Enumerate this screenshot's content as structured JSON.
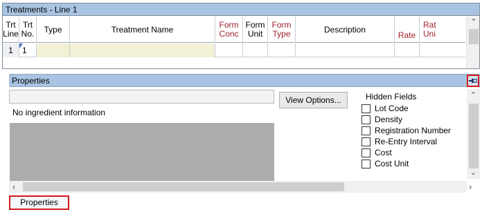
{
  "treatments_panel": {
    "title": "Treatments - Line 1",
    "columns": [
      {
        "label": "Trt\nLine",
        "required": false
      },
      {
        "label": "Trt\nNo.",
        "required": false
      },
      {
        "label": "Type",
        "required": false
      },
      {
        "label": "Treatment Name",
        "required": false
      },
      {
        "label": "Form\nConc",
        "required": true
      },
      {
        "label": "Form\nUnit",
        "required": false
      },
      {
        "label": "Form\nType",
        "required": true
      },
      {
        "label": "Description",
        "required": false
      },
      {
        "label": "Rate",
        "required": true
      },
      {
        "label": "Rat\nUni",
        "required": true
      }
    ],
    "rows": [
      {
        "trt_line": "1",
        "trt_no": "1",
        "type": "",
        "treatment_name": "",
        "form_conc": "",
        "form_unit": "",
        "form_type": "",
        "description": "",
        "rate": "",
        "rate_unit": ""
      }
    ]
  },
  "properties_panel": {
    "title": "Properties",
    "empty_message": "No ingredient information",
    "view_options_label": "View Options...",
    "hidden_fields": {
      "legend": "Hidden Fields",
      "items": [
        {
          "label": "Lot Code",
          "checked": false
        },
        {
          "label": "Density",
          "checked": false
        },
        {
          "label": "Registration Number",
          "checked": false
        },
        {
          "label": "Re-Entry Interval",
          "checked": false
        },
        {
          "label": "Cost",
          "checked": false
        },
        {
          "label": "Cost Unit",
          "checked": false
        }
      ]
    }
  },
  "bottom_tab": {
    "label": "Properties"
  },
  "icons": {
    "pin": "pin-icon",
    "scroll_up": "chevron-up-icon",
    "scroll_down": "chevron-down-icon",
    "scroll_left": "chevron-left-icon",
    "scroll_right": "chevron-right-icon"
  },
  "colors": {
    "title_bar": "#a8c4e2",
    "required_header_text": "#a0202a",
    "highlight_outline": "#d11a1a",
    "editable_cell": "#f2f1d6",
    "empty_list_area": "#acacac"
  }
}
